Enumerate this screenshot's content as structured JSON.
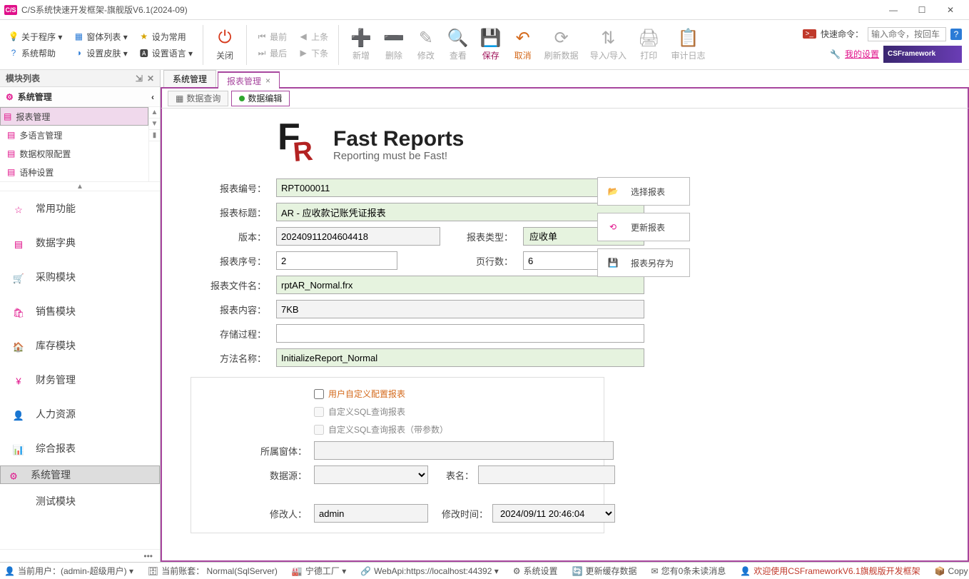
{
  "window": {
    "title": "C/S系统快速开发框架-旗舰版V6.1(2024-09)"
  },
  "menubar": {
    "col1": [
      {
        "icon": "info",
        "label": "关于程序 ▾"
      },
      {
        "icon": "help",
        "label": "系统帮助"
      }
    ],
    "col2": [
      {
        "icon": "grid",
        "label": "窗体列表 ▾"
      },
      {
        "icon": "skin",
        "label": "设置皮肤 ▾"
      }
    ],
    "col3": [
      {
        "icon": "star",
        "label": "设为常用"
      },
      {
        "icon": "lang",
        "label": "设置语言 ▾"
      }
    ],
    "close_btn": "关闭",
    "nav_first": "最前",
    "nav_prev": "上条",
    "nav_last": "最后",
    "nav_next": "下条",
    "tools": [
      {
        "id": "add",
        "label": "新增",
        "disabled": true
      },
      {
        "id": "delete",
        "label": "删除",
        "disabled": true
      },
      {
        "id": "edit",
        "label": "修改",
        "disabled": true
      },
      {
        "id": "view",
        "label": "查看",
        "disabled": true
      },
      {
        "id": "save",
        "label": "保存",
        "accent": "#a0155b"
      },
      {
        "id": "cancel",
        "label": "取消",
        "accent": "#d46a1c"
      },
      {
        "id": "refresh",
        "label": "刷新数据",
        "disabled": true
      },
      {
        "id": "import",
        "label": "导入/导入",
        "disabled": true
      },
      {
        "id": "print",
        "label": "打印",
        "disabled": true
      },
      {
        "id": "audit",
        "label": "审计日志",
        "disabled": true
      }
    ],
    "quick_label": "快速命令：",
    "quick_placeholder": "输入命令，按回车",
    "my_settings": "我的设置",
    "brand": "CSFramework"
  },
  "sidebar": {
    "header": "模块列表",
    "category": "系统管理",
    "subs": [
      {
        "label": "报表管理",
        "sel": true
      },
      {
        "label": "多语言管理"
      },
      {
        "label": "数据权限配置"
      },
      {
        "label": "语种设置"
      }
    ],
    "modules": [
      {
        "label": "常用功能"
      },
      {
        "label": "数据字典"
      },
      {
        "label": "采购模块"
      },
      {
        "label": "销售模块"
      },
      {
        "label": "库存模块"
      },
      {
        "label": "财务管理"
      },
      {
        "label": "人力资源"
      },
      {
        "label": "综合报表"
      },
      {
        "label": "系统管理",
        "sel": true
      },
      {
        "label": "测试模块"
      }
    ]
  },
  "tabs": [
    {
      "label": "系统管理",
      "active": false
    },
    {
      "label": "报表管理",
      "active": true
    }
  ],
  "subtabs": [
    {
      "label": "数据查询",
      "active": false
    },
    {
      "label": "数据编辑",
      "active": true
    }
  ],
  "logo": {
    "big": "Fast Reports",
    "sub": "Reporting must be Fast!"
  },
  "form": {
    "l_rpt_no": "报表编号：",
    "rpt_no": "RPT000011",
    "l_rpt_title": "报表标题：",
    "rpt_title": "AR - 应收款记账凭证报表",
    "l_version": "版本：",
    "version": "20240911204604418",
    "l_rpt_type": "报表类型：",
    "rpt_type": "应收单",
    "l_rpt_seq": "报表序号：",
    "rpt_seq": "2",
    "l_page_rows": "页行数：",
    "page_rows": "6",
    "l_rpt_file": "报表文件名：",
    "rpt_file": "rptAR_Normal.frx",
    "l_rpt_content": "报表内容：",
    "rpt_content": "7KB",
    "l_sp": "存储过程：",
    "sp": "",
    "l_method": "方法名称：",
    "method": "InitializeReport_Normal",
    "chk_user_custom": "用户自定义配置报表",
    "chk_sql": "自定义SQL查询报表",
    "chk_sql_param": "自定义SQL查询报表（带参数）",
    "l_form": "所属窗体：",
    "form_v": "",
    "l_ds": "数据源：",
    "ds": "",
    "l_table": "表名：",
    "table": "",
    "l_editor": "修改人：",
    "editor": "admin",
    "l_mtime": "修改时间：",
    "mtime": "2024/09/11 20:46:04"
  },
  "actions": {
    "select": "选择报表",
    "update": "更新报表",
    "saveas": "报表另存为"
  },
  "status": {
    "user": "当前用户：(admin-超级用户) ▾",
    "account": "当前账套： Normal(SqlServer)",
    "factory": "宁德工厂 ▾",
    "api": "WebApi:https://localhost:44392 ▾",
    "sys": "系统设置",
    "cache": "更新缓存数据",
    "msg": "您有0条未读消息",
    "welcome": "欢迎使用CSFrameworkV6.1旗舰版开发框架",
    "copy": "Copy"
  }
}
